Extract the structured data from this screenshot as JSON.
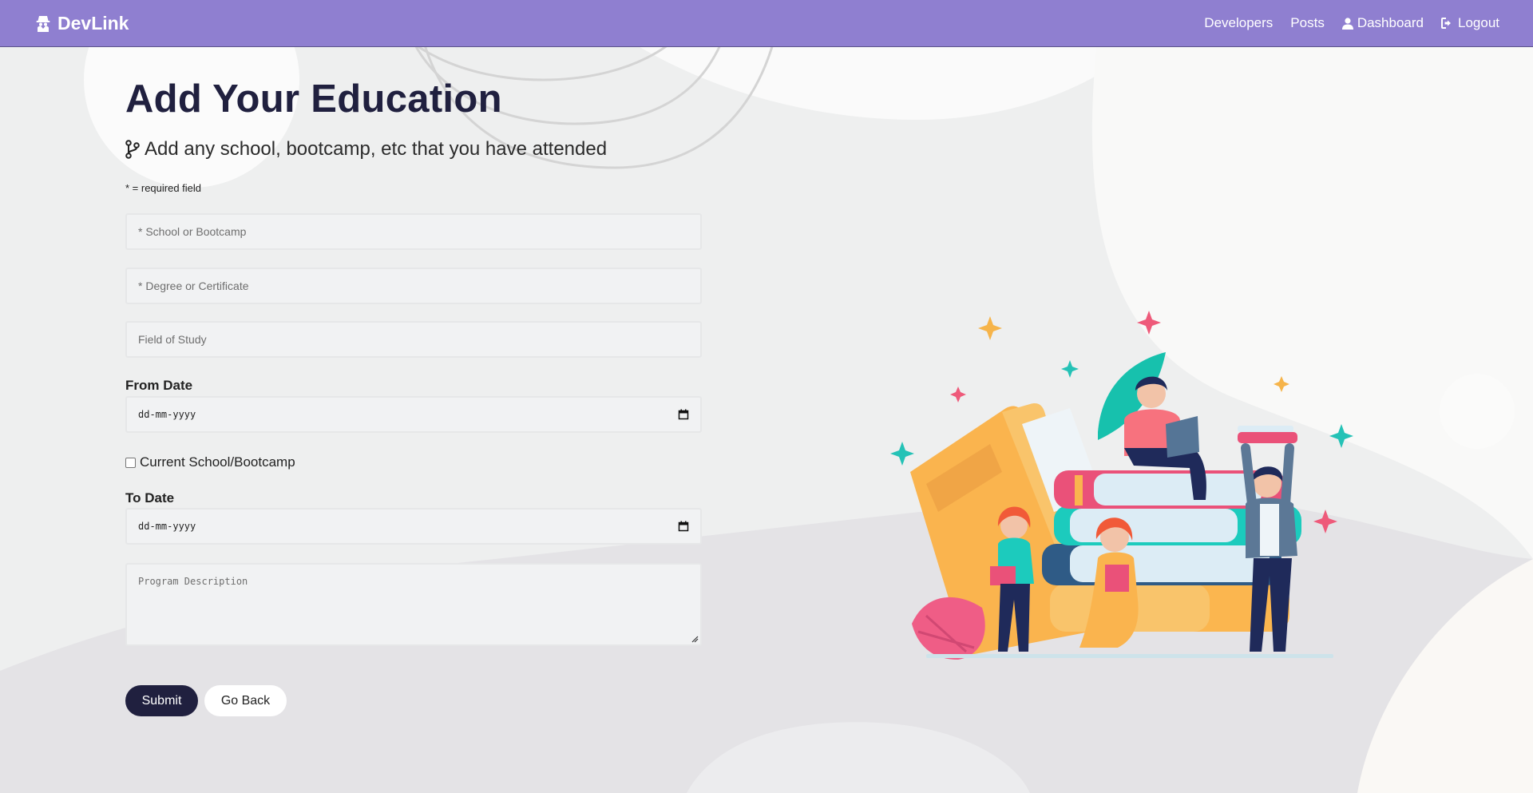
{
  "navbar": {
    "brand": "DevLink",
    "links": [
      {
        "label": "Developers"
      },
      {
        "label": "Posts"
      },
      {
        "label": "Dashboard"
      },
      {
        "label": "Logout"
      }
    ]
  },
  "page": {
    "title": "Add Your Education",
    "lead": "Add any school, bootcamp, etc that you have attended",
    "required_note": "* = required field"
  },
  "form": {
    "school_placeholder": "* School or Bootcamp",
    "degree_placeholder": "* Degree or Certificate",
    "field_placeholder": "Field of Study",
    "from_label": "From Date",
    "from_value": "dd-mm-yyyy",
    "current_label": "Current School/Bootcamp",
    "to_label": "To Date",
    "to_value": "dd-mm-yyyy",
    "description_placeholder": "Program Description",
    "submit_label": "Submit",
    "back_label": "Go Back"
  },
  "colors": {
    "navbar": "#8f7fd0",
    "primary_dark": "#20203f",
    "background": "#eeefef"
  },
  "icons": {
    "brand": "user-secret-icon",
    "lead": "code-branch-icon",
    "dashboard": "user-icon",
    "logout": "sign-out-icon",
    "date": "calendar-icon"
  }
}
